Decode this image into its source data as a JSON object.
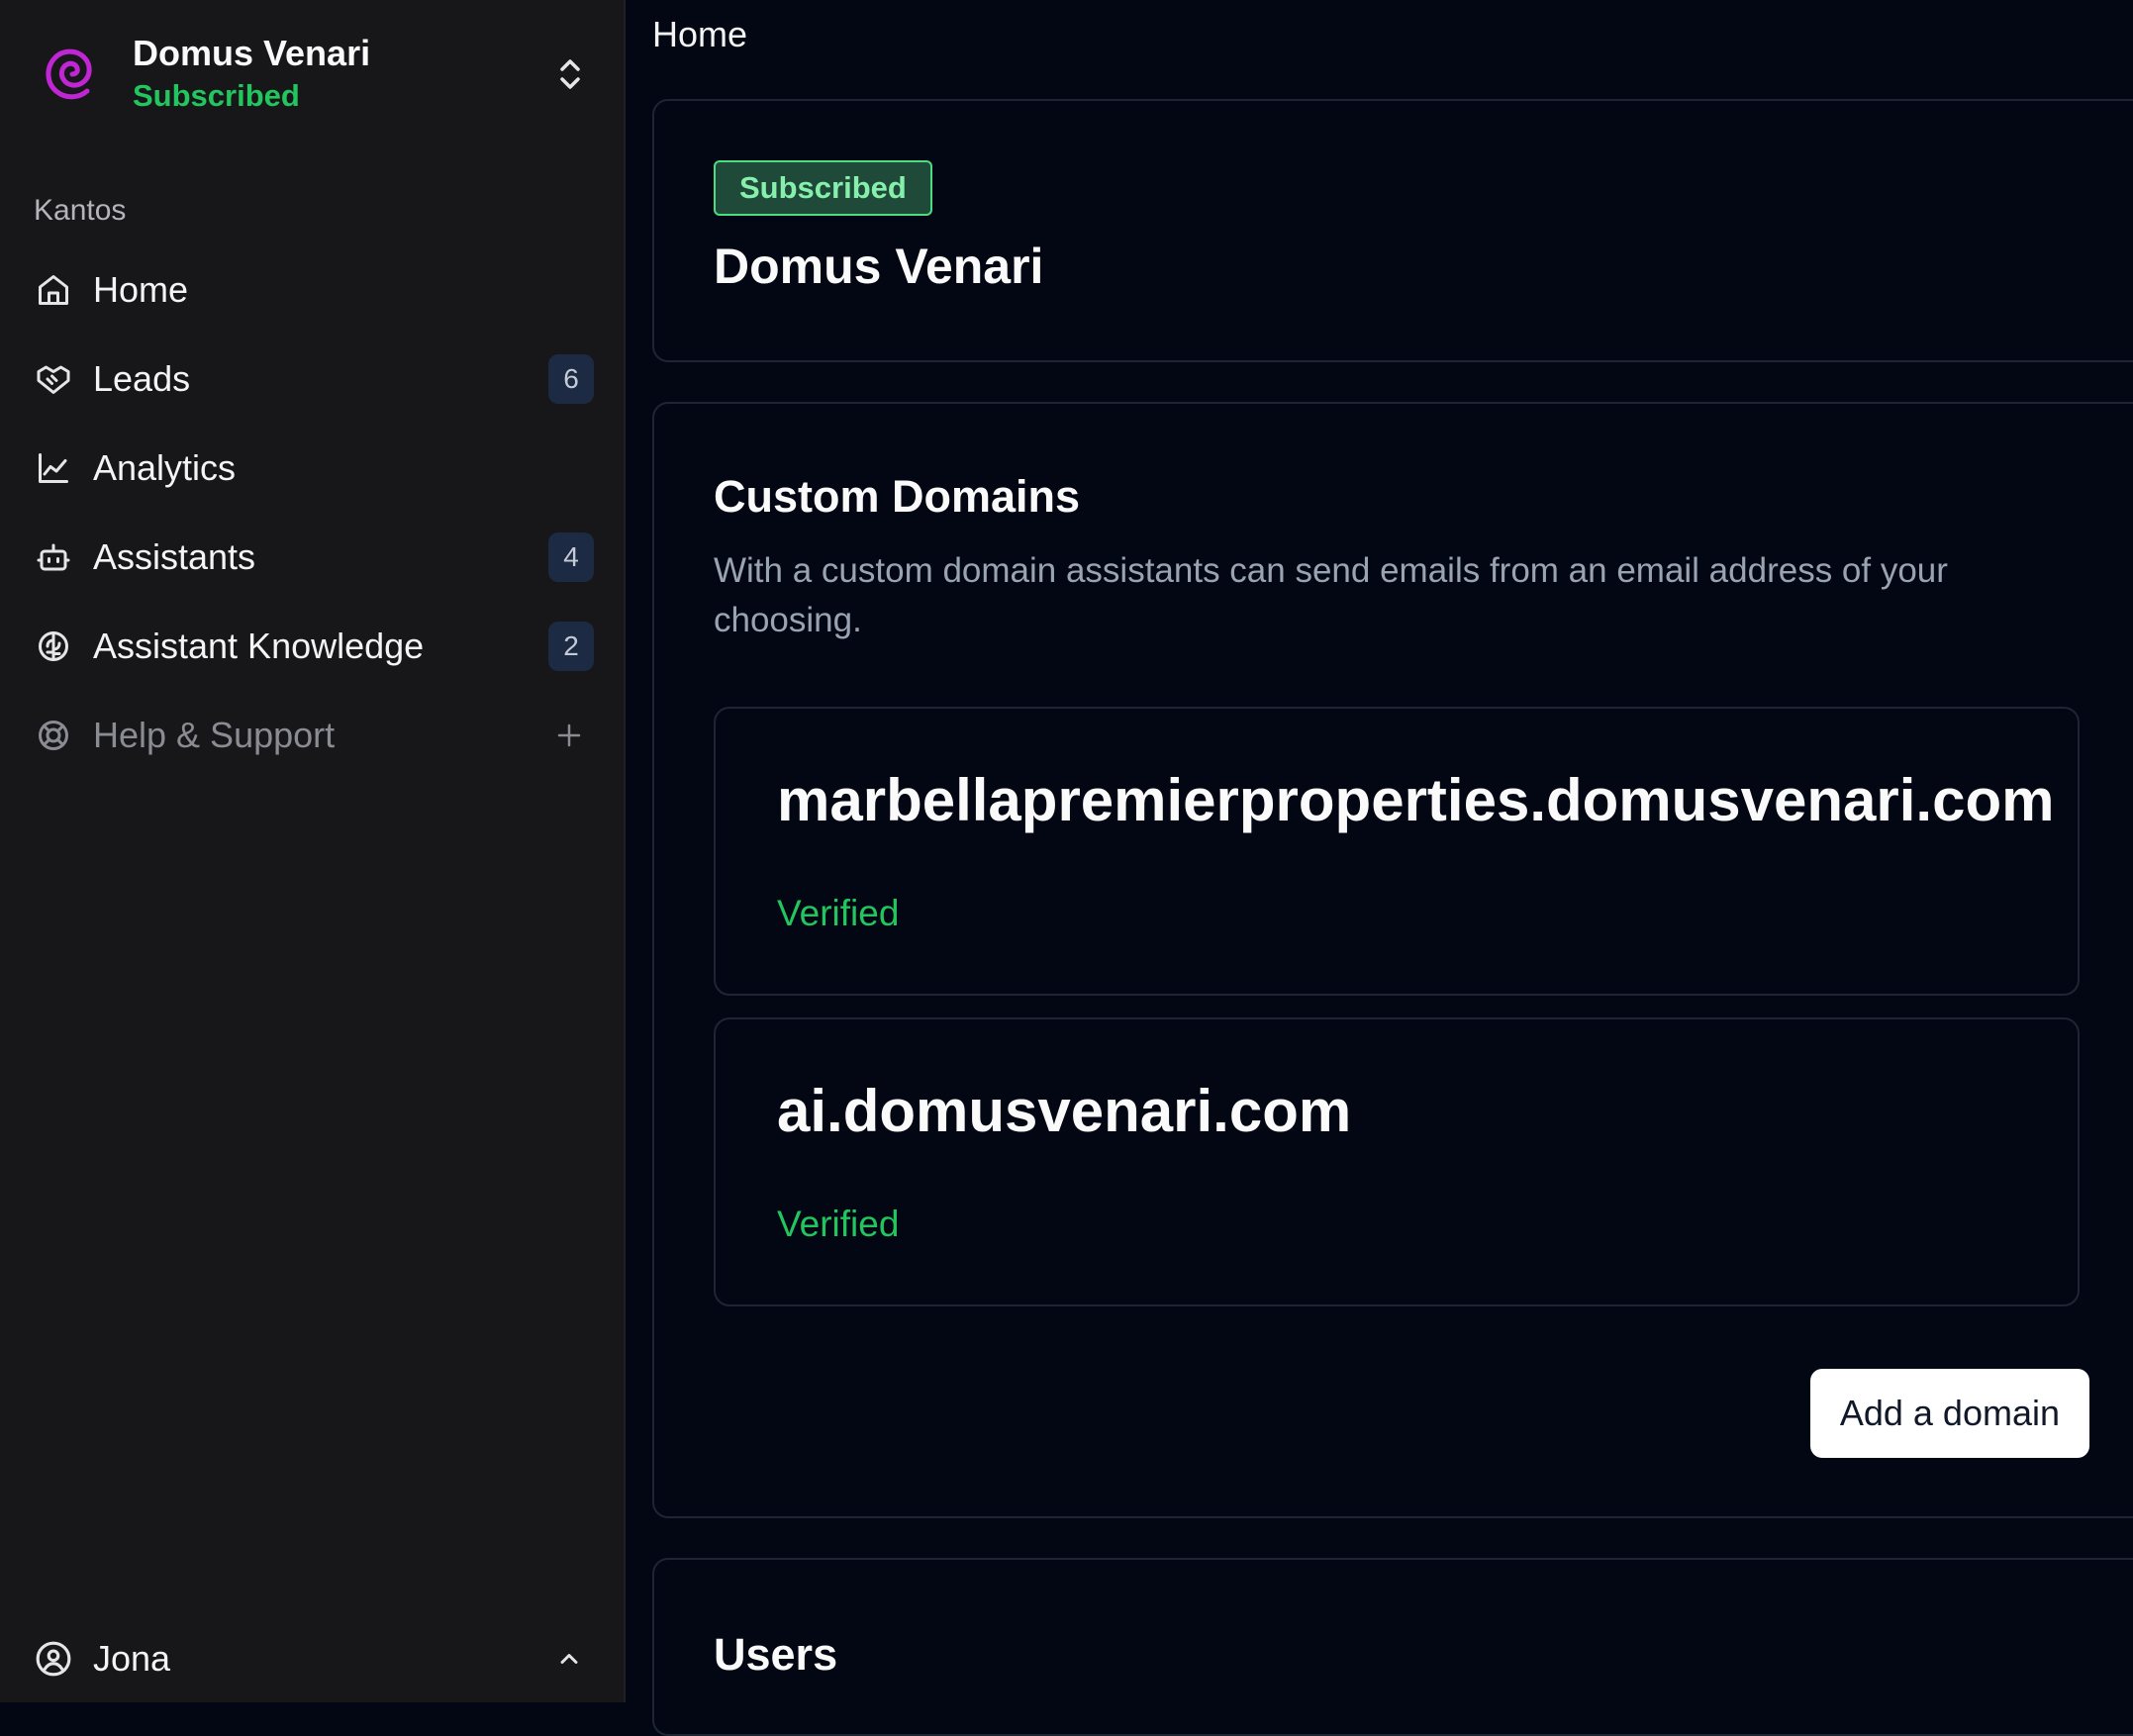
{
  "sidebar": {
    "org_name": "Domus Venari",
    "org_status": "Subscribed",
    "group_label": "Kantos",
    "items": [
      {
        "label": "Home",
        "icon": "home-icon",
        "badge": ""
      },
      {
        "label": "Leads",
        "icon": "handshake-icon",
        "badge": "6"
      },
      {
        "label": "Analytics",
        "icon": "chart-line-icon",
        "badge": ""
      },
      {
        "label": "Assistants",
        "icon": "bot-icon",
        "badge": "4"
      },
      {
        "label": "Assistant Knowledge",
        "icon": "brain-icon",
        "badge": "2"
      },
      {
        "label": "Help & Support",
        "icon": "life-buoy-icon",
        "badge": ""
      }
    ],
    "user_name": "Jona"
  },
  "main": {
    "breadcrumb": "Home",
    "header": {
      "status": "Subscribed",
      "org_name": "Domus Venari"
    },
    "domains": {
      "title": "Custom Domains",
      "description": "With a custom domain assistants can send emails from an email address of your choosing.",
      "items": [
        {
          "name": "marbellapremierproperties.domusvenari.com",
          "status": "Verified"
        },
        {
          "name": "ai.domusvenari.com",
          "status": "Verified"
        }
      ],
      "add_button": "Add a domain"
    },
    "users": {
      "title": "Users"
    }
  },
  "colors": {
    "accent_green": "#22c55e",
    "logo_magenta": "#c026d3",
    "sidebar_bg": "#17171a",
    "main_bg": "#020713"
  }
}
